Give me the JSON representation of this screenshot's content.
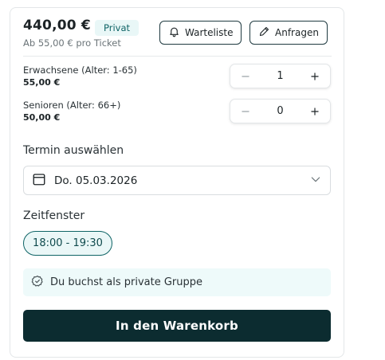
{
  "header": {
    "price": "440,00 €",
    "badge": "Privat",
    "subtitle": "Ab 55,00 € pro Ticket",
    "waitlist_label": "Warteliste",
    "inquire_label": "Anfragen"
  },
  "tickets": [
    {
      "label": "Erwachsene (Alter: 1-65)",
      "price": "55,00 €",
      "quantity": "1"
    },
    {
      "label": "Senioren (Alter: 66+)",
      "price": "50,00 €",
      "quantity": "0"
    }
  ],
  "date": {
    "title": "Termin auswählen",
    "value": "Do. 05.03.2026"
  },
  "timeslot": {
    "title": "Zeitfenster",
    "slots": [
      "18:00 - 19:30"
    ]
  },
  "info": {
    "text": "Du buchst als private Gruppe"
  },
  "cta": {
    "label": "In den Warenkorb"
  },
  "icons": {
    "bell": "bell-icon",
    "pencil": "pencil-icon",
    "minus": "minus-icon",
    "plus": "plus-icon",
    "calendar": "calendar-icon",
    "chevron": "chevron-down-icon",
    "check": "check-circle-icon"
  },
  "colors": {
    "accent": "#0f6466",
    "cta_bg": "#0c2c30",
    "badge_bg": "#e9f7f7",
    "info_bg": "#eefafa"
  }
}
